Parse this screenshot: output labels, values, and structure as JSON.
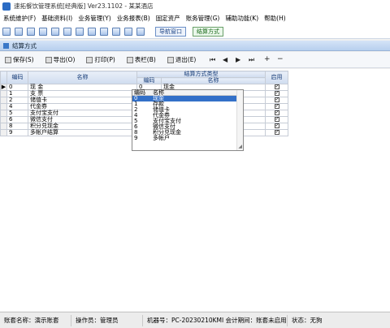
{
  "window": {
    "title": "速拓餐饮管理系统[经典版] Ver23.1102 - 某某酒店"
  },
  "menu": [
    "系统维护(F)",
    "基础资料(I)",
    "业务管理(Y)",
    "业务报表(B)",
    "固定资产",
    "账务管理(G)",
    "辅助功能(K)",
    "帮助(H)"
  ],
  "toolbar": {
    "icons": [
      "new-icon",
      "grid-icon",
      "list-icon",
      "folder-icon",
      "refresh-icon",
      "settings-icon",
      "user-icon",
      "mail-icon",
      "save-icon",
      "print-icon",
      "help-icon",
      "info-icon"
    ],
    "nav_window_label": "导航窗口",
    "settlement_label": "结算方式"
  },
  "panel": {
    "title": "结算方式"
  },
  "actions": {
    "save": "保存(S)",
    "export": "导出(O)",
    "print": "打印(P)",
    "columns": "表栏(B)",
    "exit": "退出(E)"
  },
  "nav_buttons": [
    "⏮",
    "◀",
    "▶",
    "⏭",
    "+",
    "−"
  ],
  "table": {
    "headers": {
      "code": "编码",
      "name": "名称",
      "type_group": "结算方式类型",
      "type_code": "编码",
      "type_name": "名称",
      "enabled": "启用"
    },
    "rows": [
      {
        "code": "0",
        "name": "现 金",
        "type_code": "0",
        "type_name": "现金"
      },
      {
        "code": "1",
        "name": "支 票",
        "type_code": "",
        "type_name": ""
      },
      {
        "code": "2",
        "name": "储值卡",
        "type_code": "",
        "type_name": ""
      },
      {
        "code": "4",
        "name": "代金券",
        "type_code": "",
        "type_name": ""
      },
      {
        "code": "5",
        "name": "支付宝支付",
        "type_code": "",
        "type_name": ""
      },
      {
        "code": "6",
        "name": "微信支付",
        "type_code": "",
        "type_name": ""
      },
      {
        "code": "8",
        "name": "积分兑现金",
        "type_code": "",
        "type_name": ""
      },
      {
        "code": "9",
        "name": "多帐户结算",
        "type_code": "",
        "type_name": ""
      }
    ]
  },
  "dropdown": {
    "header": {
      "code": "编码",
      "name": "名称"
    },
    "options": [
      {
        "code": "0",
        "name": "现金"
      },
      {
        "code": "1",
        "name": "存款"
      },
      {
        "code": "2",
        "name": "储值卡"
      },
      {
        "code": "4",
        "name": "代金券"
      },
      {
        "code": "5",
        "name": "支付宝支付"
      },
      {
        "code": "6",
        "name": "微信支付"
      },
      {
        "code": "8",
        "name": "积分兑现金"
      },
      {
        "code": "9",
        "name": "多帐户"
      }
    ],
    "selected_index": 0
  },
  "status": {
    "account": "账套名称：演示账套",
    "operator": "操作员：管理员",
    "machine": "机器号：PC-20230210KMI",
    "period": "会计期间：账套未启用",
    "state": "状态：无狗"
  }
}
